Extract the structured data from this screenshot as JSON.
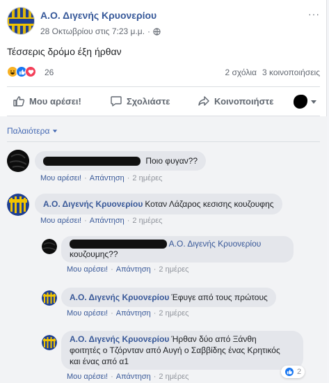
{
  "post": {
    "page_name": "Α.Ο. Διγενής Κρυονερίου",
    "timestamp": "28 Οκτωβρίου στις 7:23 μ.μ.",
    "audience_icon": "globe-icon",
    "more_label": "···",
    "text": "Τέσσερις δρόμο έξη ήρθαν",
    "reactions": {
      "icons": [
        "haha-icon",
        "like-icon",
        "love-icon"
      ],
      "count": "26"
    },
    "comments_count": "2 σχόλια",
    "shares_count": "3 κοινοποιήσεις"
  },
  "actions": {
    "like": "Μου αρέσει!",
    "comment": "Σχολιάστε",
    "share": "Κοινοποιήστε"
  },
  "older_label": "Παλαιότερα",
  "comments": [
    {
      "author": "",
      "text": "Ποιο φυγαν??",
      "like": "Μου αρέσει!",
      "reply": "Απάντηση",
      "time": "2 ημέρες"
    },
    {
      "author": "Α.Ο. Διγενής Κρυονερίου",
      "text": "Κοταν Λάζαρος κεσισης κουζουφης",
      "like": "Μου αρέσει!",
      "reply": "Απάντηση",
      "time": "2 ημέρες"
    }
  ],
  "replies": [
    {
      "author": "Α.Ο. Διγενής Κρυονερίου",
      "text": "κουζουμης??",
      "like": "Μου αρέσει!",
      "reply": "Απάντηση",
      "time": "2 ημέρες"
    },
    {
      "author": "Α.Ο. Διγενής Κρυονερίου",
      "text": "Έφυγε από τους πρώτους",
      "like": "Μου αρέσει!",
      "reply": "Απάντηση",
      "time": "2 ημέρες"
    },
    {
      "author": "Α.Ο. Διγενής Κρυονερίου",
      "text_line1": "Ήρθαν δύο από Ξάνθη",
      "text_line2": "φοιτητές ο Τζόρνταν από Αυγή ο Σαββίδης ένας Κρητικός",
      "text_line3": "και ένας από α1",
      "like": "Μου αρέσει!",
      "reply": "Απάντηση",
      "time": "2 ημέρες",
      "reactions": "2"
    }
  ],
  "colors": {
    "link": "#385898",
    "meta": "#616770",
    "bubble": "#e4e6eb",
    "crest_blue": "#1f3f91",
    "crest_gold": "#f2c400"
  }
}
